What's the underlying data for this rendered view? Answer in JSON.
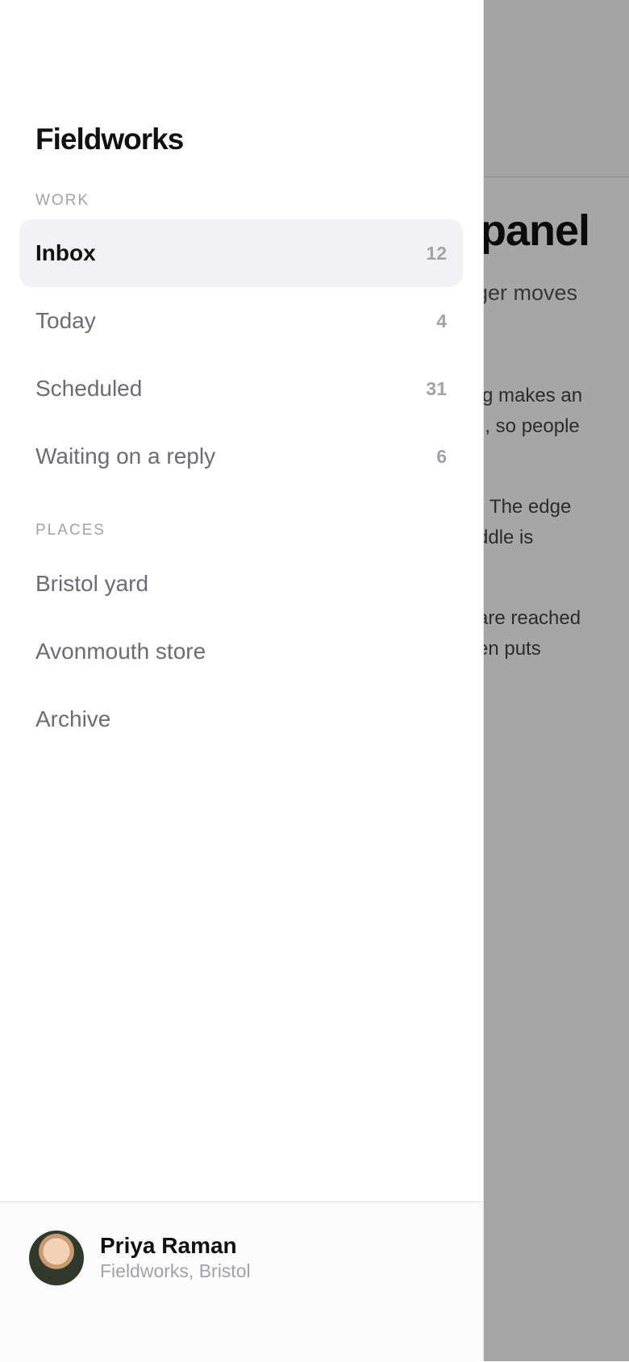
{
  "background_page": {
    "title_fragment": "panel",
    "subtitle_fragment": "ger moves",
    "paragraph1": [
      "g makes an",
      "n, so people"
    ],
    "paragraph2": [
      ". The edge",
      "ddle is"
    ],
    "paragraph3": [
      "are reached",
      "en puts"
    ]
  },
  "drawer": {
    "brand": "Fieldworks",
    "sections": {
      "work": {
        "label": "WORK",
        "items": [
          {
            "label": "Inbox",
            "count": "12",
            "active": true
          },
          {
            "label": "Today",
            "count": "4"
          },
          {
            "label": "Scheduled",
            "count": "31"
          },
          {
            "label": "Waiting on a reply",
            "count": "6"
          }
        ]
      },
      "places": {
        "label": "PLACES",
        "items": [
          {
            "label": "Bristol yard"
          },
          {
            "label": "Avonmouth store"
          },
          {
            "label": "Archive"
          }
        ]
      }
    },
    "user": {
      "name": "Priya Raman",
      "org": "Fieldworks, Bristol"
    }
  }
}
